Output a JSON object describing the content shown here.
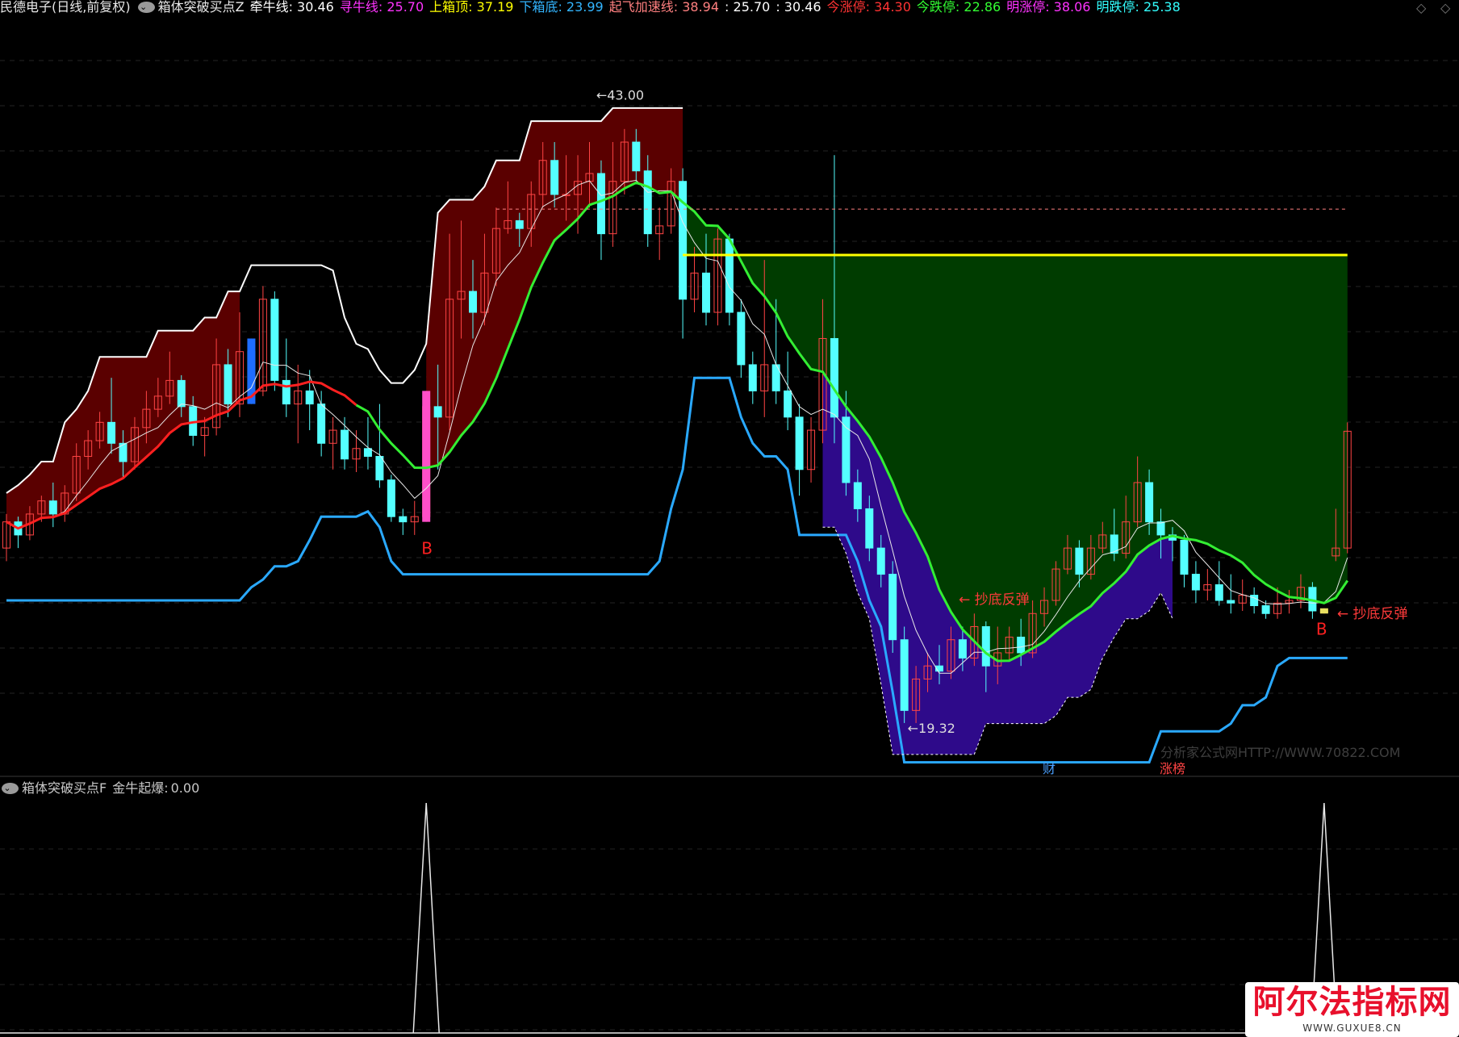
{
  "header": {
    "stock": "民德电子",
    "period": "(日线,前复权)",
    "indicator": "箱体突破买点Z",
    "lines": [
      {
        "label": "牵牛线:",
        "value": "30.46",
        "color": "#ffffff"
      },
      {
        "label": "寻牛线:",
        "value": "25.70",
        "color": "#ff33ff"
      },
      {
        "label": "上箱顶:",
        "value": "37.19",
        "color": "#ffff00"
      },
      {
        "label": "下箱底:",
        "value": "23.99",
        "color": "#33b5ff"
      },
      {
        "label": "起飞加速线:",
        "value": "38.94",
        "color": "#ff8080"
      },
      {
        "label": ":",
        "value": "25.70",
        "color": "#ffffff"
      },
      {
        "label": ":",
        "value": "30.46",
        "color": "#ffffff"
      },
      {
        "label": "今涨停:",
        "value": "34.30",
        "color": "#ff3333"
      },
      {
        "label": "今跌停:",
        "value": "22.86",
        "color": "#33ff33"
      },
      {
        "label": "明涨停:",
        "value": "38.06",
        "color": "#ff33ff"
      },
      {
        "label": "明跌停:",
        "value": "25.38",
        "color": "#33ffff"
      }
    ]
  },
  "subpanel": {
    "indicator": "箱体突破买点F",
    "label": "金牛起爆:",
    "value": "0.00"
  },
  "watermark": {
    "faint": "分析家公式网HTTP://WWW.70822.COM",
    "main": "阿尔法指标网",
    "sub": "WWW.GUXUE8.CN"
  },
  "chart_data": {
    "type": "candlestick",
    "annotations": {
      "high_label": "43.00",
      "low_label": "19.32",
      "buy_signal": "B",
      "rebound_text": "抄底反弹",
      "event_cai": "财",
      "event_zhang": "涨榜"
    },
    "candles": [
      [
        26.0,
        27.0,
        25.5,
        27.3
      ],
      [
        27.0,
        26.5,
        26.0,
        27.2
      ],
      [
        26.5,
        27.3,
        26.3,
        27.6
      ],
      [
        27.3,
        27.8,
        27.0,
        28.0
      ],
      [
        27.8,
        27.3,
        26.8,
        28.5
      ],
      [
        27.3,
        28.1,
        27.0,
        28.4
      ],
      [
        28.1,
        29.5,
        27.8,
        30.0
      ],
      [
        29.5,
        30.1,
        29.0,
        30.5
      ],
      [
        30.1,
        30.8,
        29.8,
        31.2
      ],
      [
        30.8,
        30.0,
        29.6,
        32.5
      ],
      [
        30.0,
        29.3,
        28.7,
        30.5
      ],
      [
        29.3,
        30.6,
        29.0,
        31.0
      ],
      [
        30.6,
        31.3,
        30.0,
        32.0
      ],
      [
        31.3,
        31.8,
        31.0,
        32.5
      ],
      [
        31.8,
        32.4,
        31.5,
        33.5
      ],
      [
        32.4,
        31.4,
        31.0,
        32.6
      ],
      [
        31.4,
        30.3,
        29.9,
        31.8
      ],
      [
        30.3,
        30.6,
        29.5,
        31.0
      ],
      [
        30.6,
        33.0,
        30.3,
        34.0
      ],
      [
        33.0,
        31.5,
        31.0,
        33.6
      ],
      [
        31.5,
        33.5,
        31.0,
        35.0
      ],
      [
        33.5,
        32.0,
        31.5,
        34.0
      ],
      [
        32.0,
        35.5,
        31.8,
        36.0
      ],
      [
        35.5,
        32.4,
        32.0,
        35.8
      ],
      [
        32.4,
        31.5,
        31.0,
        34.0
      ],
      [
        31.5,
        32.0,
        30.0,
        33.0
      ],
      [
        32.0,
        31.5,
        30.5,
        32.8
      ],
      [
        31.5,
        30.0,
        29.5,
        32.0
      ],
      [
        30.0,
        30.5,
        29.0,
        31.0
      ],
      [
        30.5,
        29.4,
        29.0,
        31.0
      ],
      [
        29.4,
        29.8,
        28.9,
        30.5
      ],
      [
        29.8,
        29.5,
        29.0,
        31.0
      ],
      [
        29.5,
        28.6,
        28.3,
        31.5
      ],
      [
        28.6,
        27.2,
        27.0,
        28.8
      ],
      [
        27.2,
        27.0,
        26.5,
        27.5
      ],
      [
        27.0,
        27.2,
        26.5,
        27.8
      ],
      [
        27.2,
        31.4,
        27.0,
        32.0
      ],
      [
        31.4,
        31.0,
        29.0,
        33.0
      ],
      [
        31.0,
        35.5,
        30.5,
        38.0
      ],
      [
        35.5,
        35.8,
        34.0,
        38.5
      ],
      [
        35.8,
        35.0,
        34.0,
        37.0
      ],
      [
        35.0,
        36.5,
        34.5,
        38.0
      ],
      [
        36.5,
        38.2,
        36.0,
        39.0
      ],
      [
        38.2,
        38.5,
        38.0,
        40.0
      ],
      [
        38.5,
        38.2,
        37.5,
        38.8
      ],
      [
        38.2,
        39.5,
        37.5,
        40.0
      ],
      [
        39.5,
        40.8,
        39.0,
        41.5
      ],
      [
        40.8,
        39.5,
        39.0,
        41.5
      ],
      [
        39.5,
        39.5,
        38.5,
        41.0
      ],
      [
        39.5,
        40.0,
        38.0,
        41.0
      ],
      [
        40.0,
        40.3,
        39.0,
        41.5
      ],
      [
        40.3,
        38.0,
        37.0,
        40.8
      ],
      [
        38.0,
        40.0,
        37.5,
        41.5
      ],
      [
        40.0,
        41.5,
        39.5,
        42.0
      ],
      [
        41.5,
        40.4,
        40.0,
        42.0
      ],
      [
        40.4,
        38.0,
        37.5,
        41.0
      ],
      [
        38.0,
        38.3,
        37.0,
        39.0
      ],
      [
        38.3,
        40.0,
        38.0,
        40.5
      ],
      [
        40.0,
        35.5,
        34.0,
        40.5
      ],
      [
        35.5,
        36.5,
        35.0,
        37.5
      ],
      [
        36.5,
        35.0,
        34.5,
        38.0
      ],
      [
        35.0,
        37.8,
        34.5,
        38.2
      ],
      [
        37.8,
        35.0,
        34.5,
        38.0
      ],
      [
        35.0,
        33.0,
        32.5,
        35.5
      ],
      [
        33.0,
        32.0,
        31.5,
        33.5
      ],
      [
        32.0,
        33.0,
        31.0,
        37.0
      ],
      [
        33.0,
        32.0,
        31.5,
        35.5
      ],
      [
        32.0,
        31.0,
        30.5,
        33.5
      ],
      [
        31.0,
        29.0,
        28.0,
        31.5
      ],
      [
        29.0,
        30.5,
        28.5,
        31.0
      ],
      [
        30.5,
        34.0,
        30.0,
        35.5
      ],
      [
        34.0,
        31.0,
        30.0,
        41.0
      ],
      [
        31.0,
        28.5,
        28.0,
        32.0
      ],
      [
        28.5,
        27.5,
        27.0,
        29.0
      ],
      [
        27.5,
        26.0,
        25.5,
        28.0
      ],
      [
        26.0,
        25.0,
        24.5,
        26.5
      ],
      [
        25.0,
        22.5,
        22.0,
        25.5
      ],
      [
        22.5,
        19.8,
        19.32,
        23.0
      ],
      [
        19.8,
        21.0,
        19.32,
        21.5
      ],
      [
        21.0,
        21.5,
        20.5,
        22.0
      ],
      [
        21.5,
        21.3,
        20.8,
        22.3
      ],
      [
        21.3,
        22.5,
        21.0,
        23.0
      ],
      [
        22.5,
        21.8,
        21.3,
        23.0
      ],
      [
        21.8,
        23.0,
        21.5,
        23.5
      ],
      [
        23.0,
        21.5,
        20.5,
        23.2
      ],
      [
        21.5,
        22.0,
        20.8,
        23.0
      ],
      [
        22.0,
        22.6,
        21.7,
        23.0
      ],
      [
        22.6,
        22.0,
        21.5,
        23.3
      ],
      [
        22.0,
        23.5,
        21.8,
        24.0
      ],
      [
        23.5,
        24.0,
        23.0,
        24.5
      ],
      [
        24.0,
        25.2,
        23.8,
        25.5
      ],
      [
        25.2,
        26.0,
        25.0,
        26.5
      ],
      [
        26.0,
        25.0,
        24.5,
        26.3
      ],
      [
        25.0,
        26.0,
        24.8,
        26.5
      ],
      [
        26.0,
        26.5,
        25.8,
        27.0
      ],
      [
        26.5,
        25.8,
        25.5,
        27.5
      ],
      [
        25.8,
        27.0,
        25.6,
        28.0
      ],
      [
        27.0,
        28.5,
        26.8,
        29.5
      ],
      [
        28.5,
        27.0,
        26.5,
        29.0
      ],
      [
        27.0,
        26.5,
        25.6,
        27.5
      ],
      [
        26.5,
        26.3,
        25.5,
        26.8
      ],
      [
        26.3,
        25.0,
        24.5,
        26.5
      ],
      [
        25.0,
        24.4,
        23.9,
        25.5
      ],
      [
        24.4,
        24.6,
        24.0,
        25.2
      ],
      [
        24.6,
        24.0,
        23.8,
        25.5
      ],
      [
        24.0,
        23.9,
        23.5,
        25.0
      ],
      [
        23.9,
        24.2,
        23.6,
        24.8
      ],
      [
        24.2,
        23.8,
        23.5,
        24.5
      ],
      [
        23.8,
        23.5,
        23.3,
        24.0
      ],
      [
        23.5,
        23.9,
        23.3,
        24.5
      ],
      [
        23.9,
        24.0,
        23.5,
        24.4
      ],
      [
        24.0,
        24.5,
        23.7,
        25.0
      ],
      [
        24.5,
        23.6,
        23.3,
        24.7
      ],
      [
        23.6,
        23.6,
        23.5,
        23.7
      ],
      [
        25.7,
        26.0,
        25.5,
        27.5
      ],
      [
        26.0,
        30.46,
        25.8,
        30.8
      ]
    ],
    "y_domain": [
      17.5,
      46.0
    ],
    "pink_bar_index": 36,
    "blue_bar_index": 21,
    "yellow_bar_index": 113
  }
}
